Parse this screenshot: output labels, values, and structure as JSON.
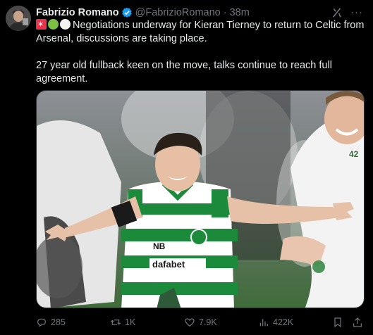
{
  "author": {
    "name": "Fabrizio Romano",
    "handle": "@FabrizioRomano",
    "separator": "·",
    "time": "38m",
    "verified_color": "#1d9bf0"
  },
  "tweet": {
    "line1": "Negotiations underway for Kieran Tierney to return to Celtic from",
    "line2": "Arsenal, discussions are taking place.",
    "para2_line1": "27 year old fullback keen on the move, talks continue to reach full",
    "para2_line2": "agreement."
  },
  "media": {
    "jersey_sponsor": "dafabet",
    "jersey_brand": "NB",
    "player_number": "42"
  },
  "actions": {
    "replies": "285",
    "reposts": "1K",
    "likes": "7.9K",
    "views": "422K"
  },
  "icons": {
    "reply": "reply-icon",
    "repost": "repost-icon",
    "like": "heart-icon",
    "views": "views-icon",
    "bookmark": "bookmark-icon",
    "share": "share-icon",
    "grok": "grok-icon",
    "more": "more-icon"
  }
}
